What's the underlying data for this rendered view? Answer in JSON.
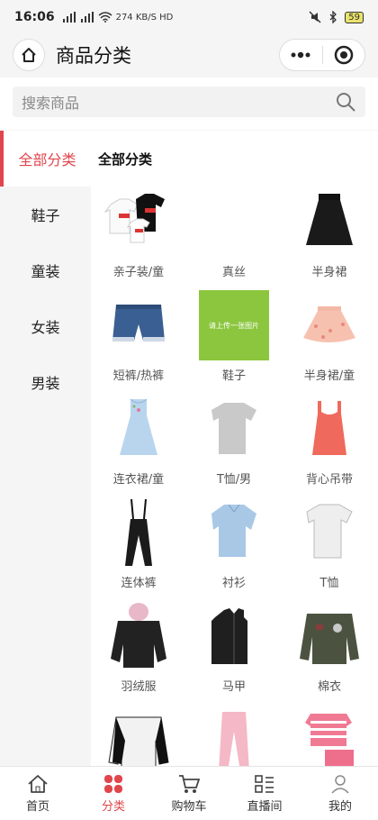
{
  "status": {
    "time": "16:06",
    "network": "274 KB/S HD",
    "battery": "59"
  },
  "nav": {
    "title": "商品分类"
  },
  "search": {
    "placeholder": "搜索商品"
  },
  "sidebar": {
    "items": [
      {
        "label": "全部分类",
        "active": true
      },
      {
        "label": "鞋子"
      },
      {
        "label": "童装"
      },
      {
        "label": "女装"
      },
      {
        "label": "男装"
      }
    ]
  },
  "content": {
    "title": "全部分类",
    "items": [
      {
        "label": "亲子装/童",
        "icon": "family-tshirts"
      },
      {
        "label": "真丝",
        "icon": "blank"
      },
      {
        "label": "半身裙",
        "icon": "black-skirt"
      },
      {
        "label": "短裤/热裤",
        "icon": "denim-shorts"
      },
      {
        "label": "鞋子",
        "icon": "upload-placeholder",
        "placeholder_text": "请上传一张图片"
      },
      {
        "label": "半身裙/童",
        "icon": "tulle-skirt"
      },
      {
        "label": "连衣裙/童",
        "icon": "child-dress"
      },
      {
        "label": "T恤/男",
        "icon": "grey-tshirt"
      },
      {
        "label": "背心吊带",
        "icon": "tank-top"
      },
      {
        "label": "连体裤",
        "icon": "jumpsuit"
      },
      {
        "label": "衬衫",
        "icon": "shirt"
      },
      {
        "label": "T恤",
        "icon": "white-tshirt"
      },
      {
        "label": "羽绒服",
        "icon": "down-jacket"
      },
      {
        "label": "马甲",
        "icon": "vest"
      },
      {
        "label": "棉衣",
        "icon": "bomber-jacket"
      },
      {
        "label": "",
        "icon": "varsity-jacket"
      },
      {
        "label": "",
        "icon": "pink-pants"
      },
      {
        "label": "",
        "icon": "striped-set"
      }
    ]
  },
  "tabs": [
    {
      "label": "首页",
      "icon": "home-icon"
    },
    {
      "label": "分类",
      "icon": "category-icon",
      "active": true
    },
    {
      "label": "购物车",
      "icon": "cart-icon"
    },
    {
      "label": "直播间",
      "icon": "live-icon"
    },
    {
      "label": "我的",
      "icon": "user-icon"
    }
  ],
  "colors": {
    "accent": "#e0464c",
    "placeholder": "#8cc63f"
  }
}
